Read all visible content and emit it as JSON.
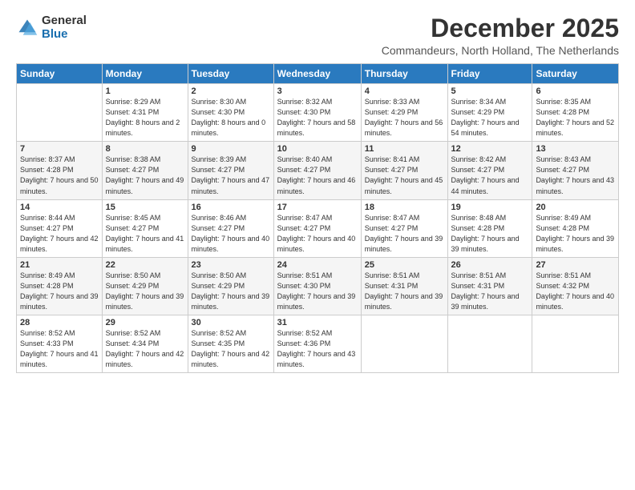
{
  "header": {
    "logo_line1": "General",
    "logo_line2": "Blue",
    "month": "December 2025",
    "location": "Commandeurs, North Holland, The Netherlands"
  },
  "weekdays": [
    "Sunday",
    "Monday",
    "Tuesday",
    "Wednesday",
    "Thursday",
    "Friday",
    "Saturday"
  ],
  "weeks": [
    [
      {
        "day": "",
        "sunrise": "",
        "sunset": "",
        "daylight": ""
      },
      {
        "day": "1",
        "sunrise": "Sunrise: 8:29 AM",
        "sunset": "Sunset: 4:31 PM",
        "daylight": "Daylight: 8 hours and 2 minutes."
      },
      {
        "day": "2",
        "sunrise": "Sunrise: 8:30 AM",
        "sunset": "Sunset: 4:30 PM",
        "daylight": "Daylight: 8 hours and 0 minutes."
      },
      {
        "day": "3",
        "sunrise": "Sunrise: 8:32 AM",
        "sunset": "Sunset: 4:30 PM",
        "daylight": "Daylight: 7 hours and 58 minutes."
      },
      {
        "day": "4",
        "sunrise": "Sunrise: 8:33 AM",
        "sunset": "Sunset: 4:29 PM",
        "daylight": "Daylight: 7 hours and 56 minutes."
      },
      {
        "day": "5",
        "sunrise": "Sunrise: 8:34 AM",
        "sunset": "Sunset: 4:29 PM",
        "daylight": "Daylight: 7 hours and 54 minutes."
      },
      {
        "day": "6",
        "sunrise": "Sunrise: 8:35 AM",
        "sunset": "Sunset: 4:28 PM",
        "daylight": "Daylight: 7 hours and 52 minutes."
      }
    ],
    [
      {
        "day": "7",
        "sunrise": "Sunrise: 8:37 AM",
        "sunset": "Sunset: 4:28 PM",
        "daylight": "Daylight: 7 hours and 50 minutes."
      },
      {
        "day": "8",
        "sunrise": "Sunrise: 8:38 AM",
        "sunset": "Sunset: 4:27 PM",
        "daylight": "Daylight: 7 hours and 49 minutes."
      },
      {
        "day": "9",
        "sunrise": "Sunrise: 8:39 AM",
        "sunset": "Sunset: 4:27 PM",
        "daylight": "Daylight: 7 hours and 47 minutes."
      },
      {
        "day": "10",
        "sunrise": "Sunrise: 8:40 AM",
        "sunset": "Sunset: 4:27 PM",
        "daylight": "Daylight: 7 hours and 46 minutes."
      },
      {
        "day": "11",
        "sunrise": "Sunrise: 8:41 AM",
        "sunset": "Sunset: 4:27 PM",
        "daylight": "Daylight: 7 hours and 45 minutes."
      },
      {
        "day": "12",
        "sunrise": "Sunrise: 8:42 AM",
        "sunset": "Sunset: 4:27 PM",
        "daylight": "Daylight: 7 hours and 44 minutes."
      },
      {
        "day": "13",
        "sunrise": "Sunrise: 8:43 AM",
        "sunset": "Sunset: 4:27 PM",
        "daylight": "Daylight: 7 hours and 43 minutes."
      }
    ],
    [
      {
        "day": "14",
        "sunrise": "Sunrise: 8:44 AM",
        "sunset": "Sunset: 4:27 PM",
        "daylight": "Daylight: 7 hours and 42 minutes."
      },
      {
        "day": "15",
        "sunrise": "Sunrise: 8:45 AM",
        "sunset": "Sunset: 4:27 PM",
        "daylight": "Daylight: 7 hours and 41 minutes."
      },
      {
        "day": "16",
        "sunrise": "Sunrise: 8:46 AM",
        "sunset": "Sunset: 4:27 PM",
        "daylight": "Daylight: 7 hours and 40 minutes."
      },
      {
        "day": "17",
        "sunrise": "Sunrise: 8:47 AM",
        "sunset": "Sunset: 4:27 PM",
        "daylight": "Daylight: 7 hours and 40 minutes."
      },
      {
        "day": "18",
        "sunrise": "Sunrise: 8:47 AM",
        "sunset": "Sunset: 4:27 PM",
        "daylight": "Daylight: 7 hours and 39 minutes."
      },
      {
        "day": "19",
        "sunrise": "Sunrise: 8:48 AM",
        "sunset": "Sunset: 4:28 PM",
        "daylight": "Daylight: 7 hours and 39 minutes."
      },
      {
        "day": "20",
        "sunrise": "Sunrise: 8:49 AM",
        "sunset": "Sunset: 4:28 PM",
        "daylight": "Daylight: 7 hours and 39 minutes."
      }
    ],
    [
      {
        "day": "21",
        "sunrise": "Sunrise: 8:49 AM",
        "sunset": "Sunset: 4:28 PM",
        "daylight": "Daylight: 7 hours and 39 minutes."
      },
      {
        "day": "22",
        "sunrise": "Sunrise: 8:50 AM",
        "sunset": "Sunset: 4:29 PM",
        "daylight": "Daylight: 7 hours and 39 minutes."
      },
      {
        "day": "23",
        "sunrise": "Sunrise: 8:50 AM",
        "sunset": "Sunset: 4:29 PM",
        "daylight": "Daylight: 7 hours and 39 minutes."
      },
      {
        "day": "24",
        "sunrise": "Sunrise: 8:51 AM",
        "sunset": "Sunset: 4:30 PM",
        "daylight": "Daylight: 7 hours and 39 minutes."
      },
      {
        "day": "25",
        "sunrise": "Sunrise: 8:51 AM",
        "sunset": "Sunset: 4:31 PM",
        "daylight": "Daylight: 7 hours and 39 minutes."
      },
      {
        "day": "26",
        "sunrise": "Sunrise: 8:51 AM",
        "sunset": "Sunset: 4:31 PM",
        "daylight": "Daylight: 7 hours and 39 minutes."
      },
      {
        "day": "27",
        "sunrise": "Sunrise: 8:51 AM",
        "sunset": "Sunset: 4:32 PM",
        "daylight": "Daylight: 7 hours and 40 minutes."
      }
    ],
    [
      {
        "day": "28",
        "sunrise": "Sunrise: 8:52 AM",
        "sunset": "Sunset: 4:33 PM",
        "daylight": "Daylight: 7 hours and 41 minutes."
      },
      {
        "day": "29",
        "sunrise": "Sunrise: 8:52 AM",
        "sunset": "Sunset: 4:34 PM",
        "daylight": "Daylight: 7 hours and 42 minutes."
      },
      {
        "day": "30",
        "sunrise": "Sunrise: 8:52 AM",
        "sunset": "Sunset: 4:35 PM",
        "daylight": "Daylight: 7 hours and 42 minutes."
      },
      {
        "day": "31",
        "sunrise": "Sunrise: 8:52 AM",
        "sunset": "Sunset: 4:36 PM",
        "daylight": "Daylight: 7 hours and 43 minutes."
      },
      {
        "day": "",
        "sunrise": "",
        "sunset": "",
        "daylight": ""
      },
      {
        "day": "",
        "sunrise": "",
        "sunset": "",
        "daylight": ""
      },
      {
        "day": "",
        "sunrise": "",
        "sunset": "",
        "daylight": ""
      }
    ]
  ]
}
